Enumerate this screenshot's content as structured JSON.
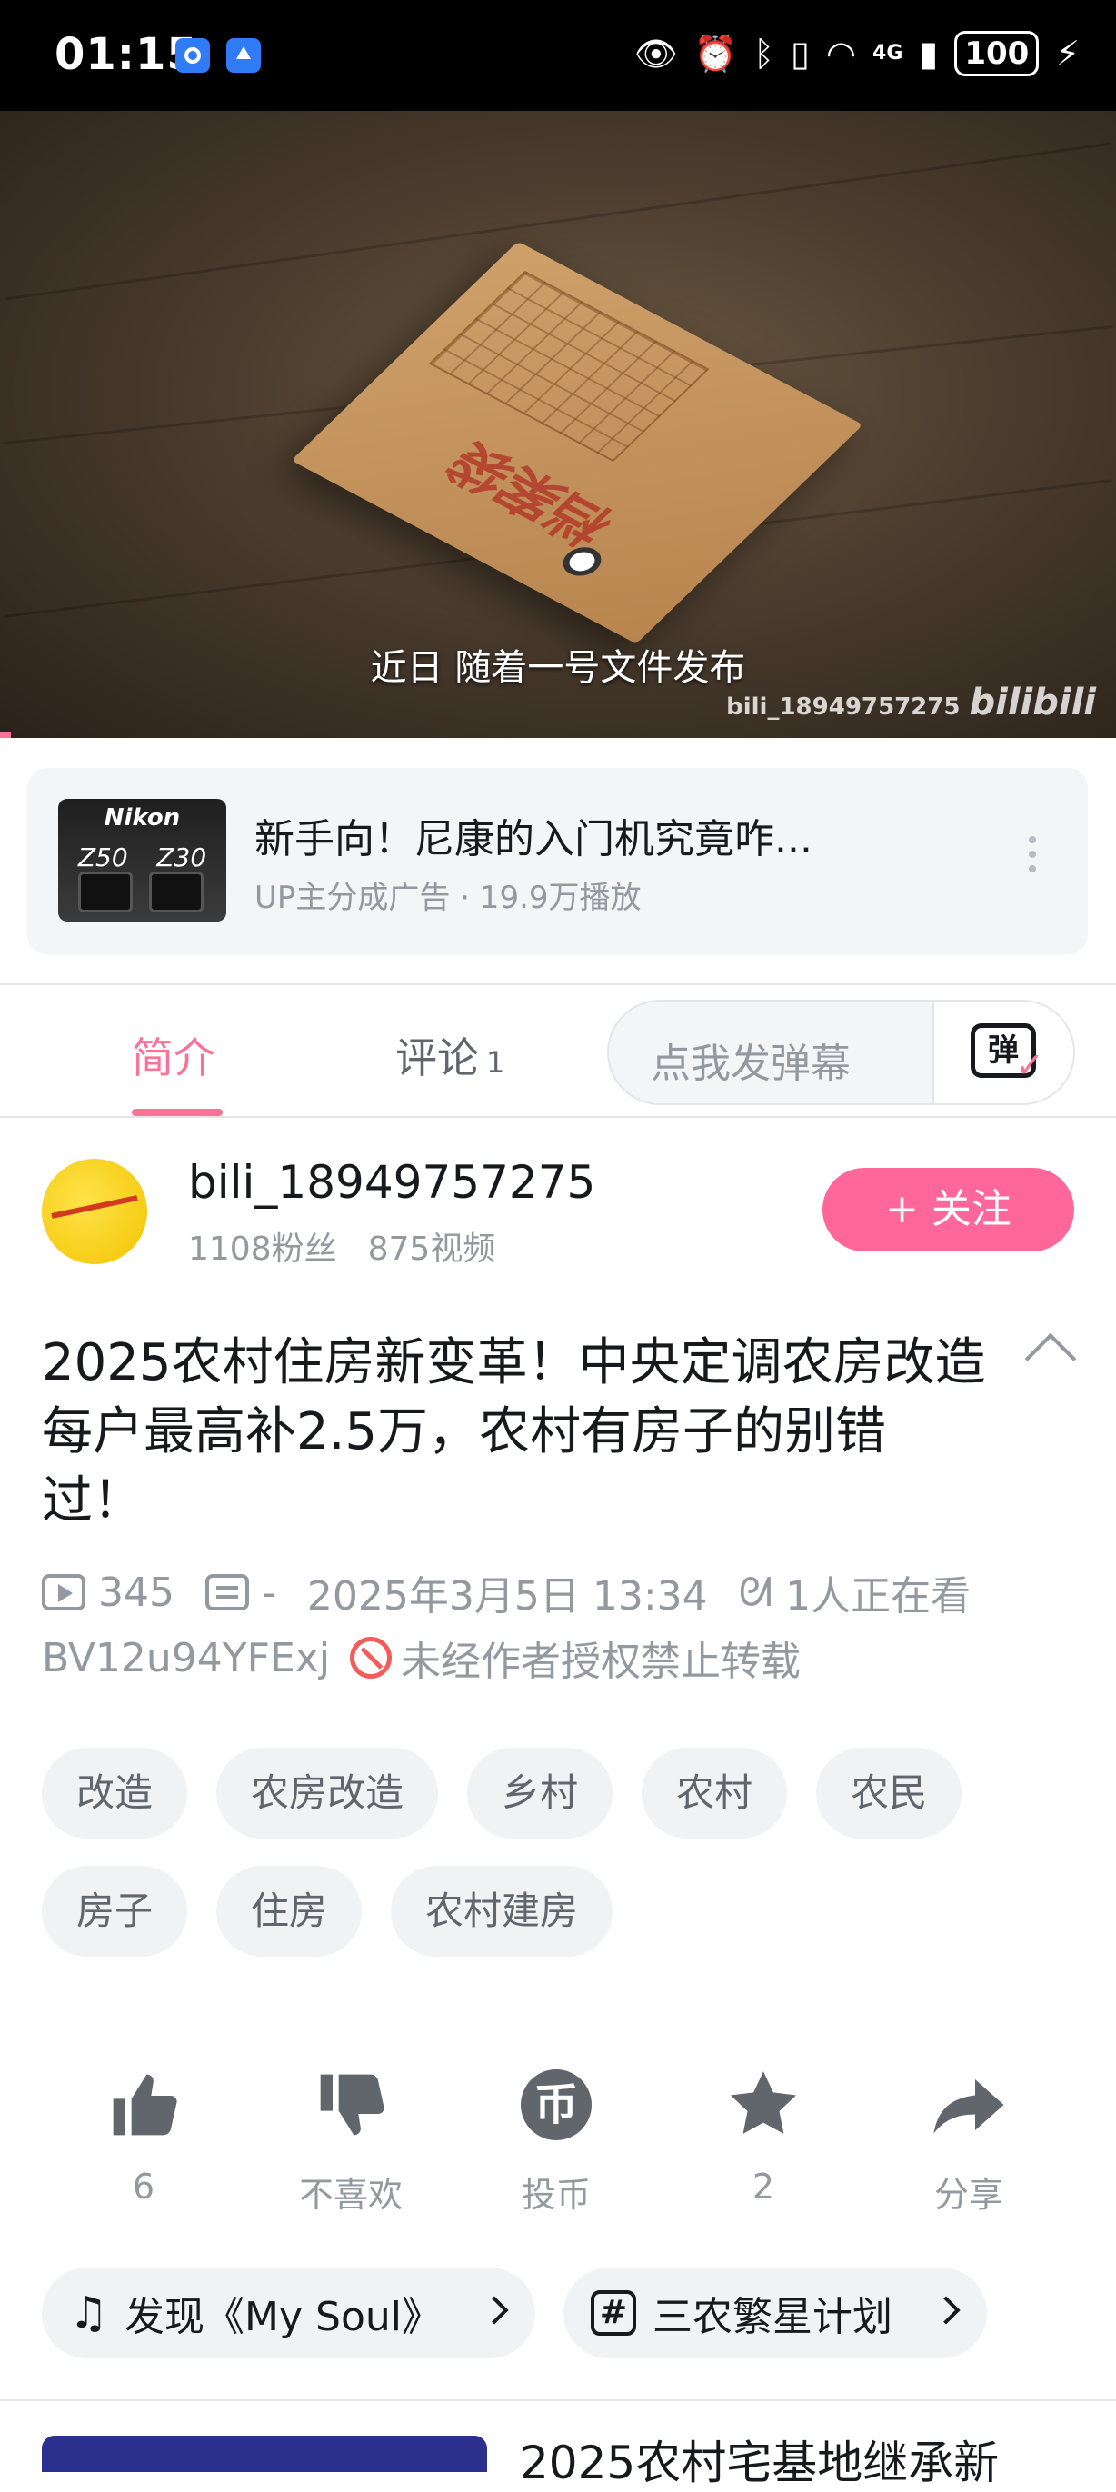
{
  "status_bar": {
    "time": "01:15",
    "battery": "100",
    "network": "4G",
    "icons": [
      "app-notification-icon",
      "upload-icon",
      "eye-icon",
      "alarm-icon",
      "bluetooth-icon",
      "vibrate-icon",
      "wifi-icon",
      "signal-icon",
      "battery-icon",
      "charging-icon"
    ]
  },
  "video": {
    "subtitle": "近日 随着一号文件发布",
    "watermark": "bili_18949757275",
    "watermark_logo": "bilibili",
    "progress_fraction": 0.01
  },
  "ad": {
    "title": "新手向！尼康的入门机究竟咋...",
    "subtitle": "UP主分成广告 · 19.9万播放",
    "thumb_brand": "Nikon",
    "thumb_models": [
      "Z50",
      "Z30"
    ]
  },
  "tabs": {
    "items": [
      {
        "label": "简介",
        "count": ""
      },
      {
        "label": "评论",
        "count": "1"
      }
    ],
    "active": 0,
    "danmaku_placeholder": "点我发弹幕",
    "danmaku_icon_glyph": "弹"
  },
  "uploader": {
    "name": "bili_18949757275",
    "fans": "1108粉丝",
    "videos": "875视频",
    "follow_label": "+ 关注"
  },
  "video_info": {
    "title": "2025农村住房新变革！中央定调农房改造每户最高补2.5万，农村有房子的别错过！",
    "plays": "345",
    "danmaku_count": "-",
    "date": "2025年3月5日 13:34",
    "watching": "1人正在看",
    "bvid": "BV12u94YFExj",
    "copyright_notice": "未经作者授权禁止转载"
  },
  "tags": [
    "改造",
    "农房改造",
    "乡村",
    "农村",
    "农民",
    "房子",
    "住房",
    "农村建房"
  ],
  "actions": [
    {
      "label": "6",
      "icon": "thumbs-up-icon"
    },
    {
      "label": "不喜欢",
      "icon": "thumbs-down-icon"
    },
    {
      "label": "投币",
      "icon": "coin-icon",
      "glyph": "币"
    },
    {
      "label": "2",
      "icon": "star-icon"
    },
    {
      "label": "分享",
      "icon": "share-icon"
    }
  ],
  "chips": {
    "music": "发现《My Soul》",
    "topic": "三农繁星计划"
  },
  "next_video_title": "2025农村宅基地继承新",
  "colors": {
    "accent": "#fb7299",
    "follow_button": "#ff6699",
    "muted_text": "#9499a0",
    "warning": "#f25d59"
  }
}
